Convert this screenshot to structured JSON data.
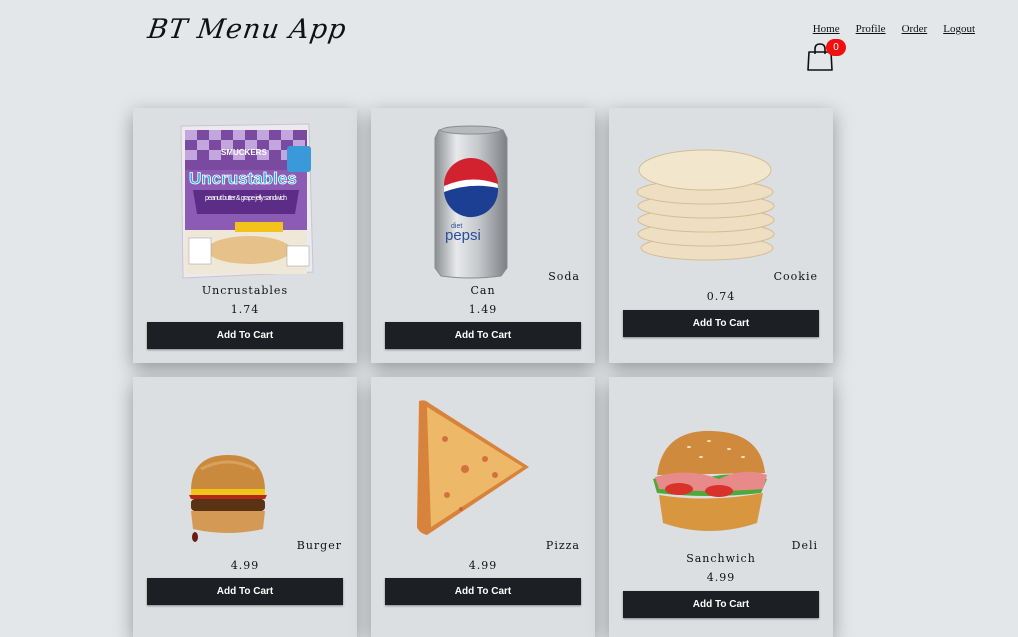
{
  "app": {
    "title": "BT Menu App"
  },
  "nav": {
    "items": [
      "Home",
      "Profile",
      "Order",
      "Logout"
    ]
  },
  "cart": {
    "count": "0",
    "icon": "shopping-bag-icon"
  },
  "colors": {
    "background": "#e3e7e9",
    "card": "#dcdfe1",
    "button": "#1c1f24",
    "badge": "#f01010"
  },
  "menu": {
    "items": [
      {
        "category": "",
        "name": "Uncrustables",
        "price": "1.74",
        "button": "Add To Cart",
        "image": "uncrustables-image"
      },
      {
        "category": "Soda",
        "name": "Can",
        "price": "1.49",
        "button": "Add To Cart",
        "image": "pepsi-can-image"
      },
      {
        "category": "Cookie",
        "name": "",
        "price": "0.74",
        "button": "Add To Cart",
        "image": "cookies-image"
      },
      {
        "category": "Burger",
        "name": "",
        "price": "4.99",
        "button": "Add To Cart",
        "image": "burger-image"
      },
      {
        "category": "Pizza",
        "name": "",
        "price": "4.99",
        "button": "Add To Cart",
        "image": "pizza-slice-image"
      },
      {
        "category": "Deli",
        "name": "Sanchwich",
        "price": "4.99",
        "button": "Add To Cart",
        "image": "deli-sandwich-image"
      }
    ]
  },
  "product_art": {
    "uncrustables_brand": "SMUCKERS",
    "uncrustables_logo": "Uncrustables",
    "uncrustables_desc": "peanut butter & grape jelly sandwich",
    "pepsi_small": "diet",
    "pepsi_logo": "pepsi"
  }
}
